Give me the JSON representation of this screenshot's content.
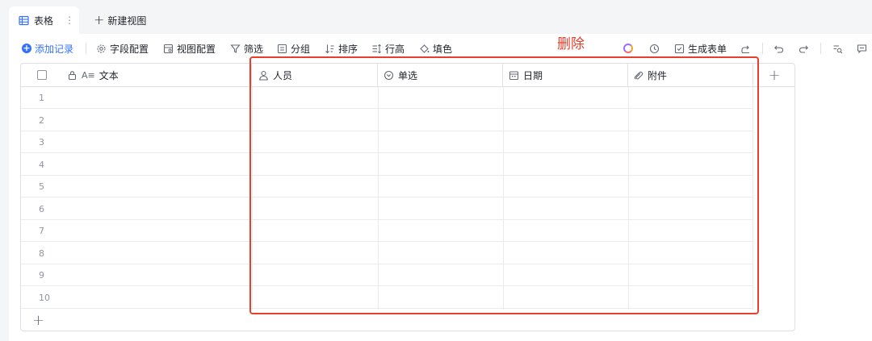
{
  "tabs": {
    "active_label": "表格",
    "more_glyph": "⋮",
    "new_view_label": "新建视图"
  },
  "toolbar": {
    "add_record": "添加记录",
    "field_config": "字段配置",
    "view_config": "视图配置",
    "filter": "筛选",
    "group": "分组",
    "sort": "排序",
    "row_height": "行高",
    "fill_color": "填色",
    "generate_form": "生成表单"
  },
  "table": {
    "columns": [
      {
        "label": "文本",
        "icon": "text-field-icon"
      },
      {
        "label": "人员",
        "icon": "person-icon"
      },
      {
        "label": "单选",
        "icon": "single-select-icon"
      },
      {
        "label": "日期",
        "icon": "calendar-icon"
      },
      {
        "label": "附件",
        "icon": "paperclip-icon"
      }
    ],
    "rows": [
      "1",
      "2",
      "3",
      "4",
      "5",
      "6",
      "7",
      "8",
      "9",
      "10"
    ],
    "add_glyph": "+"
  },
  "annotation": {
    "label": "删除",
    "color": "#e5402e"
  },
  "colors": {
    "accent": "#3370ff",
    "border": "#dee0e3",
    "muted_text": "#8f959e"
  }
}
